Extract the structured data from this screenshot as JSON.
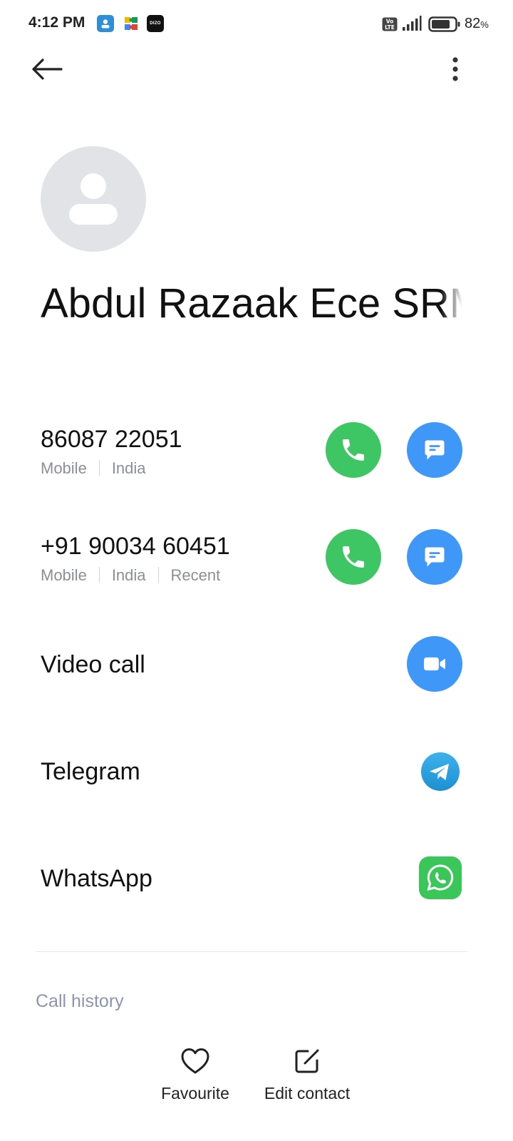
{
  "status_bar": {
    "time": "4:12 PM",
    "dizo_label": "DIZO",
    "volte_label": "Vo LTE",
    "battery_percent": "82",
    "percent_sign": "%",
    "battery_level": 0.82,
    "icons": [
      "contacts-app-icon",
      "puzzle-app-icon",
      "dizo-app-icon",
      "volte-icon",
      "signal-icon",
      "battery-icon"
    ]
  },
  "app_bar": {
    "back_icon": "arrow-left-icon",
    "more_icon": "more-vertical-icon"
  },
  "contact": {
    "name": "Abdul Razaak Ece SRM",
    "avatar_icon": "person-placeholder-icon"
  },
  "phones": [
    {
      "number": "86087 22051",
      "type": "Mobile",
      "region": "India",
      "tag": ""
    },
    {
      "number": "+91 90034 60451",
      "type": "Mobile",
      "region": "India",
      "tag": "Recent"
    }
  ],
  "features": {
    "video_call": "Video call",
    "telegram": "Telegram",
    "whatsapp": "WhatsApp"
  },
  "section": {
    "call_history": "Call history"
  },
  "bottom_actions": {
    "favourite": "Favourite",
    "edit_contact": "Edit contact"
  },
  "colors": {
    "call_green": "#3ec664",
    "message_blue": "#3f97f7",
    "telegram_blue": "#2ea3e0",
    "whatsapp_green": "#3ac659"
  }
}
